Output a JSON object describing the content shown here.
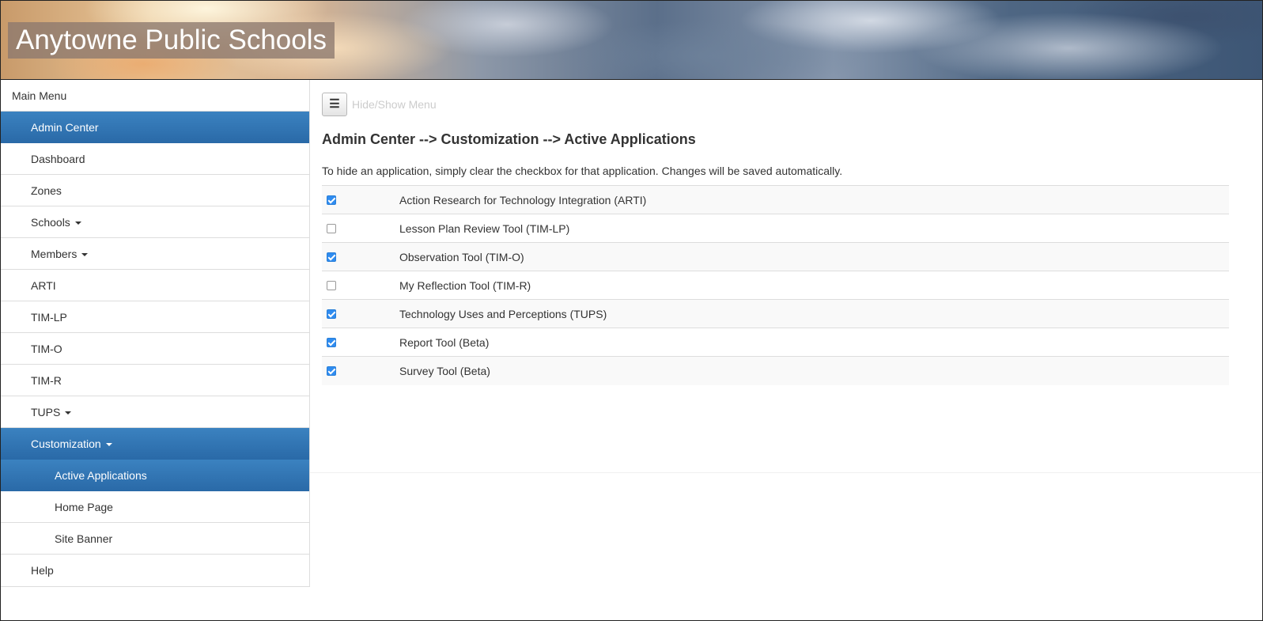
{
  "site": {
    "title": "Anytowne Public Schools"
  },
  "sidebar": {
    "header": "Main Menu",
    "items": [
      {
        "label": "Admin Center",
        "level": 1,
        "active": true,
        "caret": false
      },
      {
        "label": "Dashboard",
        "level": 1,
        "active": false,
        "caret": false
      },
      {
        "label": "Zones",
        "level": 1,
        "active": false,
        "caret": false
      },
      {
        "label": "Schools",
        "level": 1,
        "active": false,
        "caret": true
      },
      {
        "label": "Members",
        "level": 1,
        "active": false,
        "caret": true
      },
      {
        "label": "ARTI",
        "level": 1,
        "active": false,
        "caret": false
      },
      {
        "label": "TIM-LP",
        "level": 1,
        "active": false,
        "caret": false
      },
      {
        "label": "TIM-O",
        "level": 1,
        "active": false,
        "caret": false
      },
      {
        "label": "TIM-R",
        "level": 1,
        "active": false,
        "caret": false
      },
      {
        "label": "TUPS",
        "level": 1,
        "active": false,
        "caret": true
      },
      {
        "label": "Customization",
        "level": 1,
        "active": true,
        "caret": true
      },
      {
        "label": "Active Applications",
        "level": 2,
        "active": true,
        "caret": false
      },
      {
        "label": "Home Page",
        "level": 2,
        "active": false,
        "caret": false
      },
      {
        "label": "Site Banner",
        "level": 2,
        "active": false,
        "caret": false
      },
      {
        "label": "Help",
        "level": 1,
        "active": false,
        "caret": false
      }
    ]
  },
  "main": {
    "toggle_icon": "hamburger-icon",
    "toggle_label": "Hide/Show Menu",
    "page_title": "Admin Center --> Customization --> Active Applications",
    "instructions": "To hide an application, simply clear the checkbox for that application. Changes will be saved automatically.",
    "applications": [
      {
        "name": "Action Research for Technology Integration (ARTI)",
        "checked": true
      },
      {
        "name": "Lesson Plan Review Tool (TIM-LP)",
        "checked": false
      },
      {
        "name": "Observation Tool (TIM-O)",
        "checked": true
      },
      {
        "name": "My Reflection Tool (TIM-R)",
        "checked": false
      },
      {
        "name": "Technology Uses and Perceptions (TUPS)",
        "checked": true
      },
      {
        "name": "Report Tool (Beta)",
        "checked": true
      },
      {
        "name": "Survey Tool (Beta)",
        "checked": true
      }
    ]
  },
  "colors": {
    "nav_active": "#2a6aa8",
    "checkbox_checked": "#2f8cf0"
  }
}
